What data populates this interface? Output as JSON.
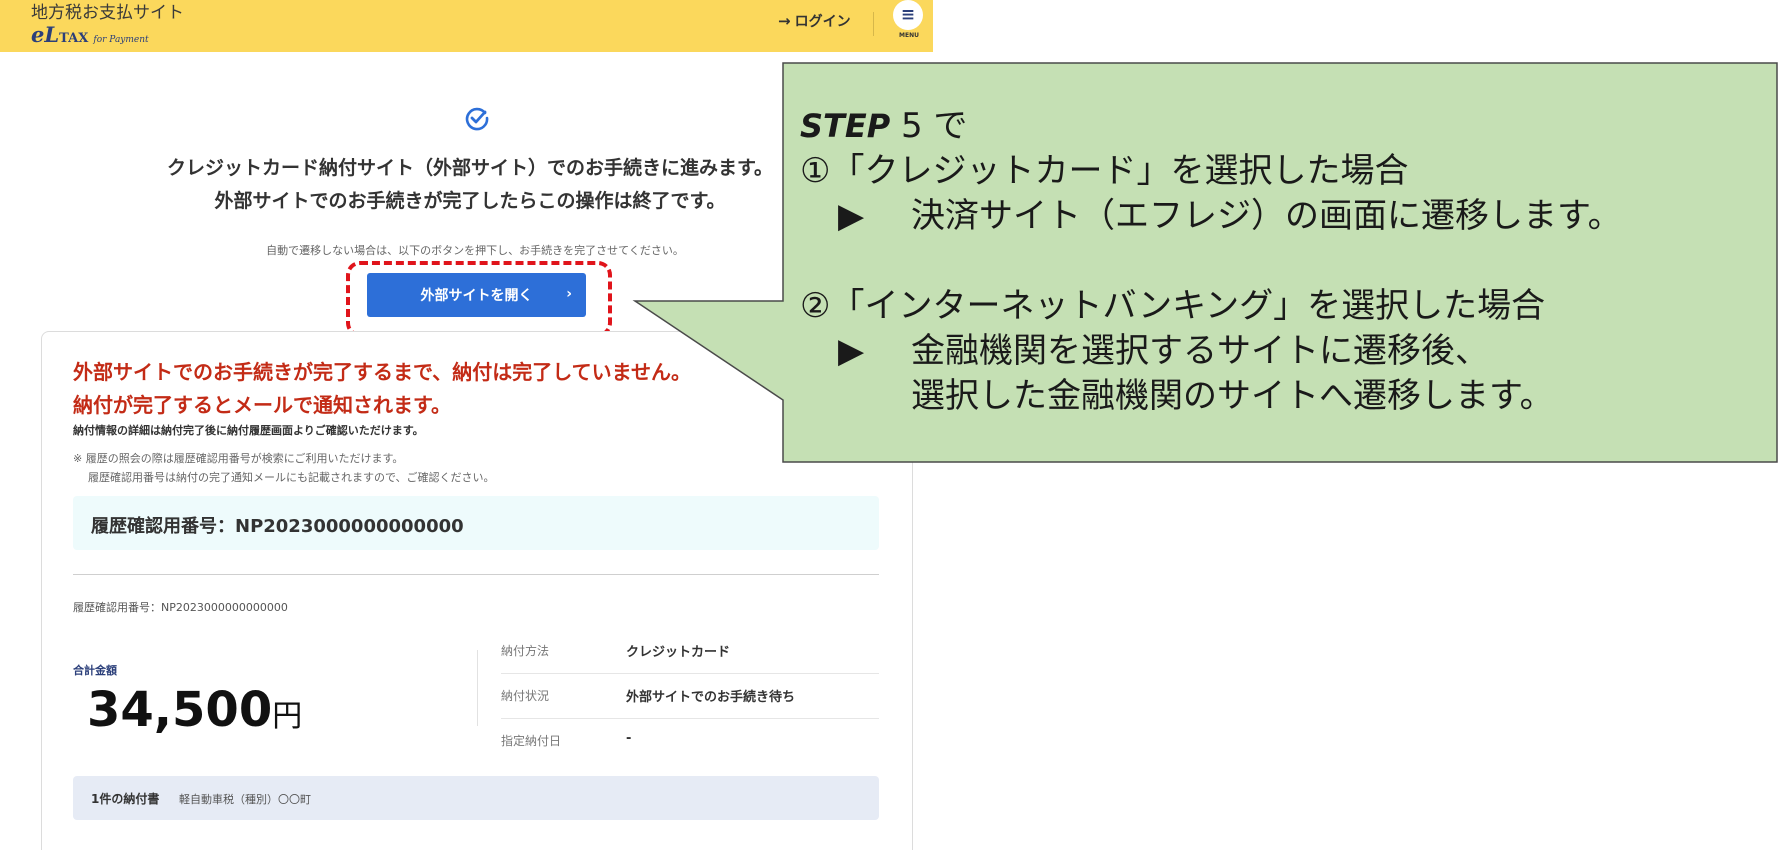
{
  "header": {
    "site_name": "地方税お支払サイト",
    "logo_el": "eL",
    "logo_tax": "TAX",
    "logo_sub": "for Payment",
    "login_label": "ログイン",
    "login_icon": "→",
    "menu_icon": "≡",
    "menu_label": "MENU",
    "bg_color": "#fbd85c"
  },
  "notice": {
    "main_line1": "クレジットカード納付サイト（外部サイト）でのお手続きに進みます。",
    "main_line2": "外部サイトでのお手続きが完了したらこの操作は終了です。",
    "auto_note": "自動で遷移しない場合は、以下のボタンを押下し、お手続きを完了させてください。",
    "button_label": "外部サイトを開く",
    "button_chevron": "›"
  },
  "card": {
    "warning_line1": "外部サイトでのお手続きが完了するまで、納付は完了していません。",
    "warning_line2": "納付が完了するとメールで通知されます。",
    "warning_sub": "納付情報の詳細は納付完了後に納付履歴画面よりご確認いただけます。",
    "note_line1": "※ 履歴の照会の際は履歴確認用番号が検索にご利用いただけます。",
    "note_line2": "履歴確認用番号は納付の完了通知メールにも記載されますので、ご確認ください。",
    "history_id_label": "履歴確認用番号：NP2023000000000000",
    "history_id_small": "履歴確認用番号：NP2023000000000000",
    "total_label": "合計金額",
    "total_amount": "34,500",
    "total_unit": "円",
    "info_rows": [
      {
        "label": "納付方法",
        "value": "クレジットカード"
      },
      {
        "label": "納付状況",
        "value": "外部サイトでのお手続き待ち"
      },
      {
        "label": "指定納付日",
        "value": "-"
      }
    ],
    "doc_count": "1件の納付書",
    "doc_desc": "軽自動車税（種別）〇〇町"
  },
  "callout": {
    "step_word": "STEP",
    "step_rest": " 5 で",
    "case1_title": "①「クレジットカード」を選択した場合",
    "case1_arrow": "▶",
    "case1_text": "決済サイト（エフレジ）の画面に遷移します。",
    "case2_title": "②「インターネットバンキング」を選択した場合",
    "case2_arrow": "▶",
    "case2_text1": "金融機関を選択するサイトに遷移後、",
    "case2_text2": "選択した金融機関のサイトへ遷移します。",
    "fill_color": "#c5e0b4",
    "border_color": "#4a4a4a",
    "highlight_color": "#e0141b"
  }
}
